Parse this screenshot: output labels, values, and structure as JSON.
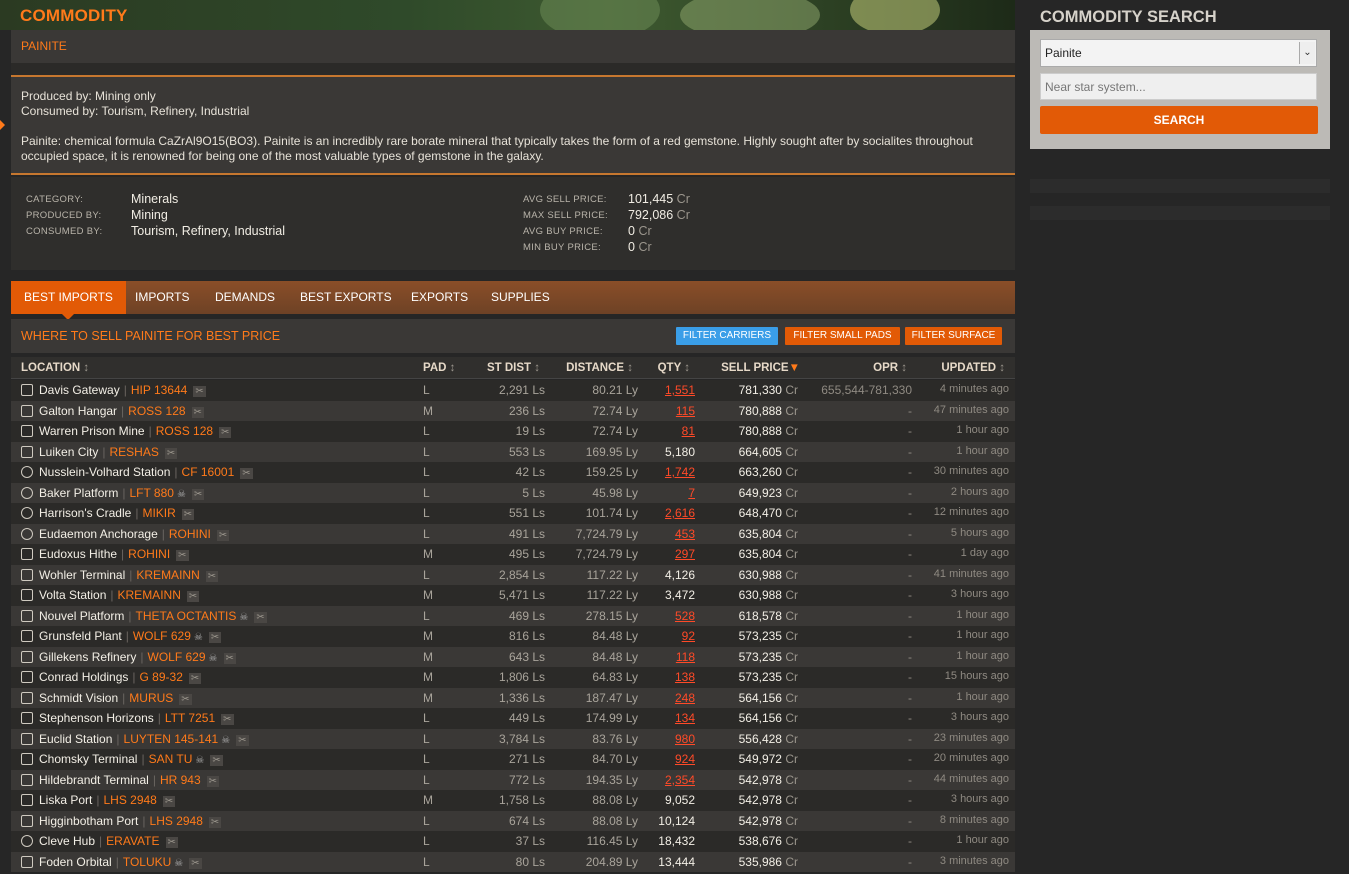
{
  "header": {
    "title": "COMMODITY",
    "commodity_name": "PAINITE"
  },
  "description": {
    "produced_by_line": "Produced by: Mining only",
    "consumed_by_line": "Consumed by: Tourism, Refinery, Industrial",
    "text": "Painite: chemical formula CaZrAl9O15(BO3). Painite is an incredibly rare borate mineral that typically takes the form of a red gemstone. Highly sought after by socialites throughout occupied space, it is renowned for being one of the most valuable types of gemstone in the galaxy."
  },
  "stats": {
    "category_label": "CATEGORY:",
    "category": "Minerals",
    "produced_label": "PRODUCED BY:",
    "produced": "Mining",
    "consumed_label": "CONSUMED BY:",
    "consumed": "Tourism, Refinery, Industrial",
    "avg_sell_label": "AVG SELL PRICE:",
    "avg_sell": "101,445",
    "max_sell_label": "MAX SELL PRICE:",
    "max_sell": "792,086",
    "avg_buy_label": "AVG BUY PRICE:",
    "avg_buy": "0",
    "min_buy_label": "MIN BUY PRICE:",
    "min_buy": "0",
    "currency": "Cr"
  },
  "tabs": [
    "BEST IMPORTS",
    "IMPORTS",
    "DEMANDS",
    "BEST EXPORTS",
    "EXPORTS",
    "SUPPLIES"
  ],
  "section": {
    "title": "WHERE TO SELL PAINITE FOR BEST PRICE",
    "filter_carriers": "FILTER CARRIERS",
    "filter_small_pads": "FILTER SMALL PADS",
    "filter_surface": "FILTER SURFACE"
  },
  "table": {
    "columns": [
      "LOCATION",
      "PAD",
      "ST DIST",
      "DISTANCE",
      "QTY",
      "SELL PRICE",
      "OPR",
      "UPDATED"
    ],
    "rows": [
      {
        "name": "Davis Gateway",
        "system": "HIP 13644",
        "skull": false,
        "pad": "L",
        "st_dist": "2,291 Ls",
        "distance": "80.21 Ly",
        "qty": "1,551",
        "qty_red": true,
        "price": "781,330",
        "opr": "655,544-781,330",
        "updated": "4 minutes ago",
        "icon": "station"
      },
      {
        "name": "Galton Hangar",
        "system": "ROSS 128",
        "skull": false,
        "pad": "M",
        "st_dist": "236 Ls",
        "distance": "72.74 Ly",
        "qty": "115",
        "qty_red": true,
        "price": "780,888",
        "opr": "-",
        "updated": "47 minutes ago",
        "icon": "outpost"
      },
      {
        "name": "Warren Prison Mine",
        "system": "ROSS 128",
        "skull": false,
        "pad": "L",
        "st_dist": "19 Ls",
        "distance": "72.74 Ly",
        "qty": "81",
        "qty_red": true,
        "price": "780,888",
        "opr": "-",
        "updated": "1 hour ago",
        "icon": "station"
      },
      {
        "name": "Luiken City",
        "system": "RESHAS",
        "skull": false,
        "pad": "L",
        "st_dist": "553 Ls",
        "distance": "169.95 Ly",
        "qty": "5,180",
        "qty_red": false,
        "price": "664,605",
        "opr": "-",
        "updated": "1 hour ago",
        "icon": "station"
      },
      {
        "name": "Nusslein-Volhard Station",
        "system": "CF 16001",
        "skull": false,
        "pad": "L",
        "st_dist": "42 Ls",
        "distance": "159.25 Ly",
        "qty": "1,742",
        "qty_red": true,
        "price": "663,260",
        "opr": "-",
        "updated": "30 minutes ago",
        "icon": "round"
      },
      {
        "name": "Baker Platform",
        "system": "LFT 880",
        "skull": true,
        "pad": "L",
        "st_dist": "5 Ls",
        "distance": "45.98 Ly",
        "qty": "7",
        "qty_red": true,
        "price": "649,923",
        "opr": "-",
        "updated": "2 hours ago",
        "icon": "round"
      },
      {
        "name": "Harrison's Cradle",
        "system": "MIKIR",
        "skull": false,
        "pad": "L",
        "st_dist": "551 Ls",
        "distance": "101.74 Ly",
        "qty": "2,616",
        "qty_red": true,
        "price": "648,470",
        "opr": "-",
        "updated": "12 minutes ago",
        "icon": "round"
      },
      {
        "name": "Eudaemon Anchorage",
        "system": "ROHINI",
        "skull": false,
        "pad": "L",
        "st_dist": "491 Ls",
        "distance": "7,724.79 Ly",
        "qty": "453",
        "qty_red": true,
        "price": "635,804",
        "opr": "-",
        "updated": "5 hours ago",
        "icon": "round"
      },
      {
        "name": "Eudoxus Hithe",
        "system": "ROHINI",
        "skull": false,
        "pad": "M",
        "st_dist": "495 Ls",
        "distance": "7,724.79 Ly",
        "qty": "297",
        "qty_red": true,
        "price": "635,804",
        "opr": "-",
        "updated": "1 day ago",
        "icon": "outpost"
      },
      {
        "name": "Wohler Terminal",
        "system": "KREMAINN",
        "skull": false,
        "pad": "L",
        "st_dist": "2,854 Ls",
        "distance": "117.22 Ly",
        "qty": "4,126",
        "qty_red": false,
        "price": "630,988",
        "opr": "-",
        "updated": "41 minutes ago",
        "icon": "station"
      },
      {
        "name": "Volta Station",
        "system": "KREMAINN",
        "skull": false,
        "pad": "M",
        "st_dist": "5,471 Ls",
        "distance": "117.22 Ly",
        "qty": "3,472",
        "qty_red": false,
        "price": "630,988",
        "opr": "-",
        "updated": "3 hours ago",
        "icon": "outpost"
      },
      {
        "name": "Nouvel Platform",
        "system": "THETA OCTANTIS",
        "skull": true,
        "pad": "L",
        "st_dist": "469 Ls",
        "distance": "278.15 Ly",
        "qty": "528",
        "qty_red": true,
        "price": "618,578",
        "opr": "-",
        "updated": "1 hour ago",
        "icon": "station"
      },
      {
        "name": "Grunsfeld Plant",
        "system": "WOLF 629",
        "skull": true,
        "pad": "M",
        "st_dist": "816 Ls",
        "distance": "84.48 Ly",
        "qty": "92",
        "qty_red": true,
        "price": "573,235",
        "opr": "-",
        "updated": "1 hour ago",
        "icon": "outpost"
      },
      {
        "name": "Gillekens Refinery",
        "system": "WOLF 629",
        "skull": true,
        "pad": "M",
        "st_dist": "643 Ls",
        "distance": "84.48 Ly",
        "qty": "118",
        "qty_red": true,
        "price": "573,235",
        "opr": "-",
        "updated": "1 hour ago",
        "icon": "outpost"
      },
      {
        "name": "Conrad Holdings",
        "system": "G 89-32",
        "skull": false,
        "pad": "M",
        "st_dist": "1,806 Ls",
        "distance": "64.83 Ly",
        "qty": "138",
        "qty_red": true,
        "price": "573,235",
        "opr": "-",
        "updated": "15 hours ago",
        "icon": "outpost"
      },
      {
        "name": "Schmidt Vision",
        "system": "MURUS",
        "skull": false,
        "pad": "M",
        "st_dist": "1,336 Ls",
        "distance": "187.47 Ly",
        "qty": "248",
        "qty_red": true,
        "price": "564,156",
        "opr": "-",
        "updated": "1 hour ago",
        "icon": "outpost"
      },
      {
        "name": "Stephenson Horizons",
        "system": "LTT 7251",
        "skull": false,
        "pad": "L",
        "st_dist": "449 Ls",
        "distance": "174.99 Ly",
        "qty": "134",
        "qty_red": true,
        "price": "564,156",
        "opr": "-",
        "updated": "3 hours ago",
        "icon": "station"
      },
      {
        "name": "Euclid Station",
        "system": "LUYTEN 145-141",
        "skull": true,
        "pad": "L",
        "st_dist": "3,784 Ls",
        "distance": "83.76 Ly",
        "qty": "980",
        "qty_red": true,
        "price": "556,428",
        "opr": "-",
        "updated": "23 minutes ago",
        "icon": "station"
      },
      {
        "name": "Chomsky Terminal",
        "system": "SAN TU",
        "skull": true,
        "pad": "L",
        "st_dist": "271 Ls",
        "distance": "84.70 Ly",
        "qty": "924",
        "qty_red": true,
        "price": "549,972",
        "opr": "-",
        "updated": "20 minutes ago",
        "icon": "station"
      },
      {
        "name": "Hildebrandt Terminal",
        "system": "HR 943",
        "skull": false,
        "pad": "L",
        "st_dist": "772 Ls",
        "distance": "194.35 Ly",
        "qty": "2,354",
        "qty_red": true,
        "price": "542,978",
        "opr": "-",
        "updated": "44 minutes ago",
        "icon": "station"
      },
      {
        "name": "Liska Port",
        "system": "LHS 2948",
        "skull": false,
        "pad": "M",
        "st_dist": "1,758 Ls",
        "distance": "88.08 Ly",
        "qty": "9,052",
        "qty_red": false,
        "price": "542,978",
        "opr": "-",
        "updated": "3 hours ago",
        "icon": "outpost"
      },
      {
        "name": "Higginbotham Port",
        "system": "LHS 2948",
        "skull": false,
        "pad": "L",
        "st_dist": "674 Ls",
        "distance": "88.08 Ly",
        "qty": "10,124",
        "qty_red": false,
        "price": "542,978",
        "opr": "-",
        "updated": "8 minutes ago",
        "icon": "station"
      },
      {
        "name": "Cleve Hub",
        "system": "ERAVATE",
        "skull": false,
        "pad": "L",
        "st_dist": "37 Ls",
        "distance": "116.45 Ly",
        "qty": "18,432",
        "qty_red": false,
        "price": "538,676",
        "opr": "-",
        "updated": "1 hour ago",
        "icon": "round"
      },
      {
        "name": "Foden Orbital",
        "system": "TOLUKU",
        "skull": true,
        "pad": "L",
        "st_dist": "80 Ls",
        "distance": "204.89 Ly",
        "qty": "13,444",
        "qty_red": false,
        "price": "535,986",
        "opr": "-",
        "updated": "3 minutes ago",
        "icon": "station"
      }
    ]
  },
  "sidebar": {
    "title": "COMMODITY SEARCH",
    "selected_commodity": "Painite",
    "near_placeholder": "Near star system...",
    "search_label": "SEARCH"
  },
  "colors": {
    "accent": "#ff7a1a",
    "button": "#e25a06",
    "carriers_button": "#3a9ee8",
    "red_qty": "#ff4a28"
  }
}
